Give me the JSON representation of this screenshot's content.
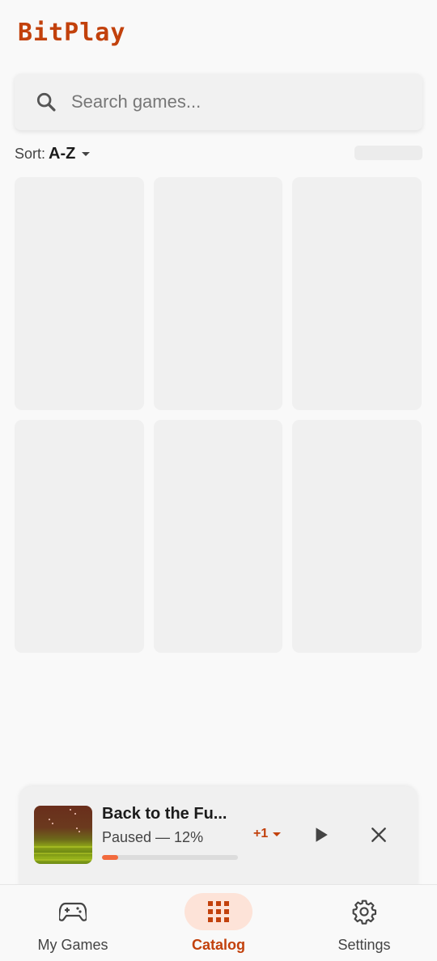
{
  "app": {
    "title": "BitPlay"
  },
  "search": {
    "placeholder": "Search games..."
  },
  "sort": {
    "label": "Sort:",
    "value": "A-Z"
  },
  "catalog": {
    "placeholder_cards": 6
  },
  "now_playing": {
    "title": "Back to the Fu...",
    "status": "Paused — 12%",
    "progress": 0.12,
    "queue_more": "+1"
  },
  "bottom_nav": {
    "items": [
      {
        "label": "My Games",
        "icon": "gamepad-icon",
        "active": false
      },
      {
        "label": "Catalog",
        "icon": "grid-icon",
        "active": true
      },
      {
        "label": "Settings",
        "icon": "gear-icon",
        "active": false
      }
    ]
  },
  "colors": {
    "accent": "#c2410c",
    "progress": "#f26a3d",
    "active_pill": "#fde3d8"
  }
}
